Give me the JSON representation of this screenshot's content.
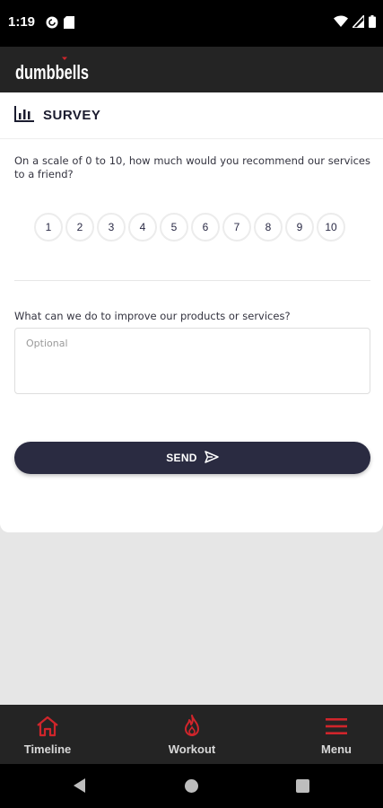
{
  "status_bar": {
    "time": "1:19",
    "left_icons": [
      "pocket-casts-icon",
      "sd-card-icon"
    ],
    "right_icons": [
      "wifi-icon",
      "cell-signal-icon",
      "battery-icon"
    ]
  },
  "header": {
    "logo_text": "DUMBBELLS",
    "brand_color": "#d0252b",
    "background": "#242424"
  },
  "survey": {
    "title": "SURVEY",
    "title_icon": "bar-chart-icon",
    "question_1": "On a scale of 0 to 10, how much would you recommend our services to a friend?",
    "ratings": [
      "1",
      "2",
      "3",
      "4",
      "5",
      "6",
      "7",
      "8",
      "9",
      "10"
    ],
    "question_2": "What can we do to improve our products or services?",
    "improve_placeholder": "Optional",
    "improve_value": "",
    "send_label": "SEND",
    "send_icon": "send-icon",
    "button_color": "#2a2b41"
  },
  "bottom_nav": {
    "items": [
      {
        "label": "Timeline",
        "icon": "home-icon"
      },
      {
        "label": "Workout",
        "icon": "flame-icon"
      },
      {
        "label": "Menu",
        "icon": "hamburger-menu-icon"
      }
    ],
    "icon_color": "#d0252b"
  },
  "system_nav": {
    "buttons": [
      "back-icon",
      "home-circle-icon",
      "recents-icon"
    ]
  }
}
